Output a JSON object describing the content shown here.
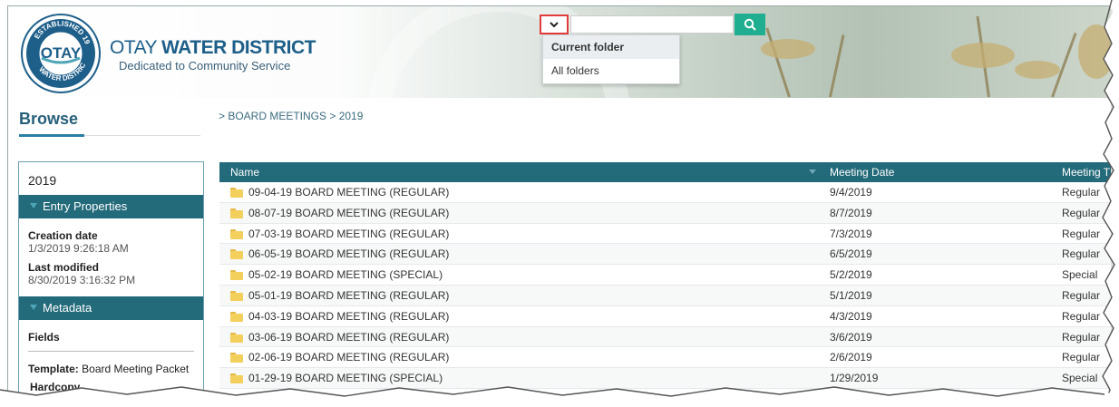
{
  "header": {
    "logo_ring_top": "ESTABLISHED 1956",
    "logo_center": "OTAY",
    "logo_ring_bottom": "WATER DISTRICT",
    "title_regular": "OTAY ",
    "title_bold": "WATER DISTRICT",
    "subtitle": "Dedicated to Community Service"
  },
  "search": {
    "scope_icon": "chevron-down-icon",
    "value": "",
    "search_icon": "search-icon",
    "options": [
      "Current folder",
      "All folders"
    ],
    "selected": "Current folder"
  },
  "sidebar": {
    "browse_label": "Browse",
    "entry_name": "2019",
    "entry_properties_label": "Entry Properties",
    "creation_label": "Creation date",
    "creation_value": "1/3/2019 9:26:18 AM",
    "modified_label": "Last modified",
    "modified_value": "8/30/2019 3:16:32 PM",
    "metadata_label": "Metadata",
    "fields_label": "Fields",
    "template_label": "Template:",
    "template_value": "Board Meeting Packet",
    "hardcopy_label": "Hardcopy"
  },
  "breadcrumb": "> BOARD MEETINGS > 2019",
  "table": {
    "columns": [
      "Name",
      "Meeting Date",
      "Meeting T"
    ],
    "rows": [
      {
        "name": "09-04-19 BOARD MEETING (REGULAR)",
        "date": "9/4/2019",
        "type": "Regular"
      },
      {
        "name": "08-07-19 BOARD MEETING (REGULAR)",
        "date": "8/7/2019",
        "type": "Regular"
      },
      {
        "name": "07-03-19 BOARD MEETING (REGULAR)",
        "date": "7/3/2019",
        "type": "Regular"
      },
      {
        "name": "06-05-19 BOARD MEETING (REGULAR)",
        "date": "6/5/2019",
        "type": "Regular"
      },
      {
        "name": "05-02-19 BOARD MEETING (SPECIAL)",
        "date": "5/2/2019",
        "type": "Special"
      },
      {
        "name": "05-01-19 BOARD MEETING (REGULAR)",
        "date": "5/1/2019",
        "type": "Regular"
      },
      {
        "name": "04-03-19 BOARD MEETING (REGULAR)",
        "date": "4/3/2019",
        "type": "Regular"
      },
      {
        "name": "03-06-19 BOARD MEETING (REGULAR)",
        "date": "3/6/2019",
        "type": "Regular"
      },
      {
        "name": "02-06-19 BOARD MEETING (REGULAR)",
        "date": "2/6/2019",
        "type": "Regular"
      },
      {
        "name": "01-29-19 BOARD MEETING (SPECIAL)",
        "date": "1/29/2019",
        "type": "Special"
      }
    ]
  },
  "colors": {
    "teal_header": "#236a7a",
    "search_button": "#1fae8f",
    "brand_blue": "#1e5f8a",
    "folder_yellow": "#f3cf5c",
    "highlight_red": "#e23b3b"
  }
}
